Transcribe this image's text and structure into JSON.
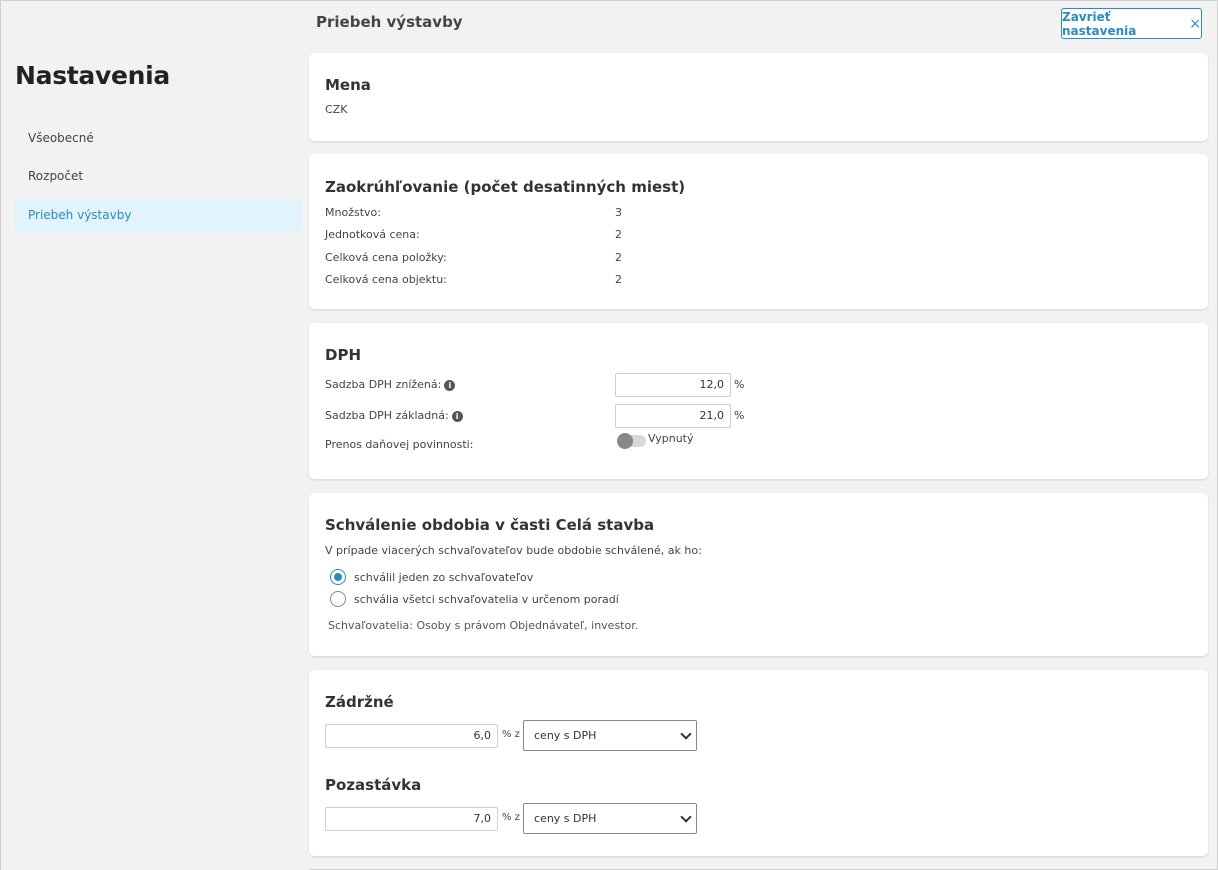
{
  "sidebar": {
    "title": "Nastavenia",
    "items": [
      {
        "label": "Všeobecné"
      },
      {
        "label": "Rozpočet"
      },
      {
        "label": "Priebeh výstavby"
      }
    ]
  },
  "header": {
    "title": "Priebeh výstavby",
    "close_label": "Zavrieť nastavenia",
    "close_icon": "×"
  },
  "mena": {
    "title": "Mena",
    "value": "CZK"
  },
  "rounding": {
    "title": "Zaokrúhľovanie (počet desatinných miest)",
    "rows": [
      {
        "label": "Množstvo:",
        "value": "3"
      },
      {
        "label": "Jednotková cena:",
        "value": "2"
      },
      {
        "label": "Celková cena položky:",
        "value": "2"
      },
      {
        "label": "Celková cena objektu:",
        "value": "2"
      }
    ]
  },
  "dph": {
    "title": "DPH",
    "reduced_label": "Sadzba DPH znížená:",
    "reduced_value": "12,0",
    "base_label": "Sadzba DPH základná:",
    "base_value": "21,0",
    "percent": "%",
    "transfer_label": "Prenos daňovej povinnosti:",
    "transfer_state": "Vypnutý",
    "info_glyph": "i"
  },
  "approval": {
    "title": "Schválenie obdobia v časti Celá stavba",
    "description": "V prípade viacerých schvaľovateľov bude obdobie schválené, ak ho:",
    "options": [
      {
        "label": "schválil jeden zo schvaľovateľov",
        "checked": true
      },
      {
        "label": "schvália všetci schvaľovatelia v určenom poradí",
        "checked": false
      }
    ],
    "note": "Schvaľovatelia: Osoby s právom Objednávateľ, investor."
  },
  "retention": {
    "title": "Zádržné",
    "value": "6,0",
    "percent_of": "% z",
    "select_value": "ceny s DPH"
  },
  "hold": {
    "title": "Pozastávka",
    "value": "7,0",
    "percent_of": "% z",
    "select_value": "ceny s DPH"
  },
  "colors": {
    "accent": "#2a8bbf",
    "active_bg": "#e1f3fb",
    "page_bg": "#f2f2f2"
  }
}
